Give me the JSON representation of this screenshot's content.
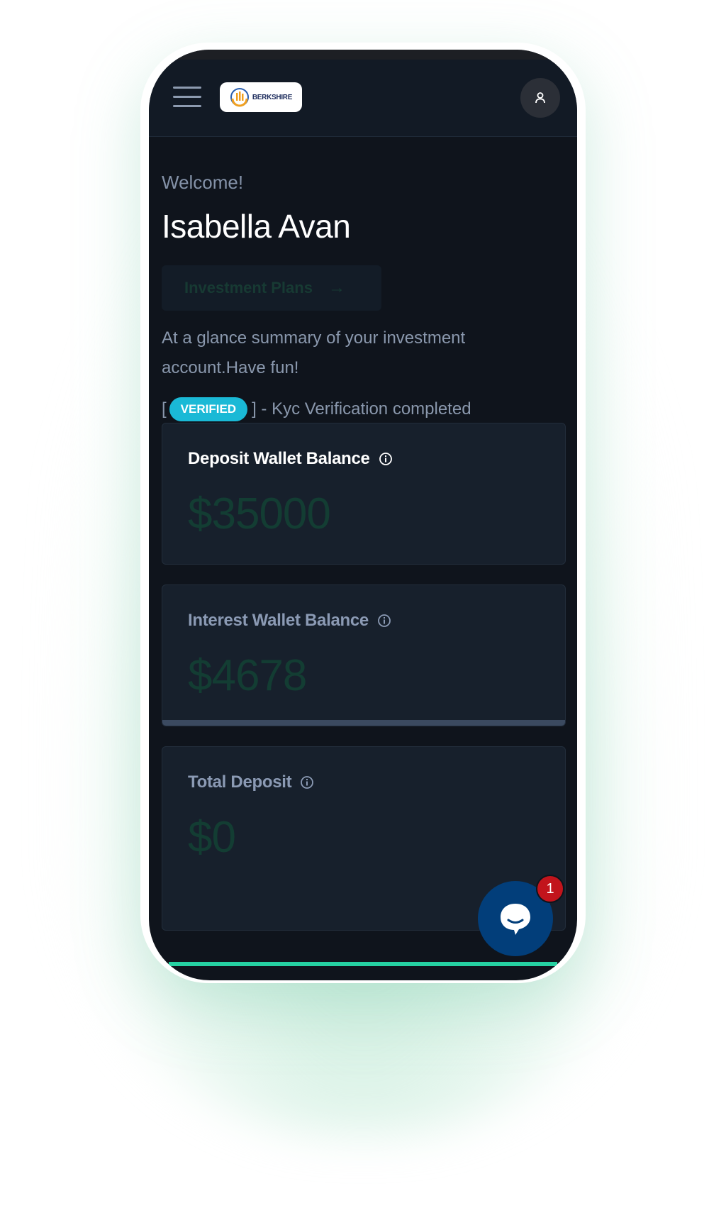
{
  "header": {
    "logo_text": "BERKSHIRE",
    "menu_icon": "hamburger-menu-icon",
    "avatar_icon": "user-icon"
  },
  "welcome": {
    "greeting": "Welcome!",
    "name": "Isabella Avan"
  },
  "investment_button": {
    "label": "Investment Plans",
    "arrow": "→"
  },
  "summary": "At a glance summary of your investment account.Have fun!",
  "kyc": {
    "open": "[",
    "badge": "VERIFIED",
    "text": "] - Kyc Verification completed"
  },
  "cards": [
    {
      "title": "Deposit Wallet Balance",
      "value": "$35000",
      "title_color": "#ffffff"
    },
    {
      "title": "Interest Wallet Balance",
      "value": "$4678",
      "title_color": "#8b9ab4"
    },
    {
      "title": "Total Deposit",
      "value": "$0",
      "title_color": "#8b9ab4"
    }
  ],
  "chat": {
    "icon": "chat-bubble-icon",
    "unread_count": "1"
  },
  "colors": {
    "background": "#0f141c",
    "card": "#17202c",
    "accent_green": "#25d1a2",
    "badge_cyan": "#1ab9d6",
    "chat_blue": "#023e7a",
    "notification_red": "#c2141c"
  }
}
